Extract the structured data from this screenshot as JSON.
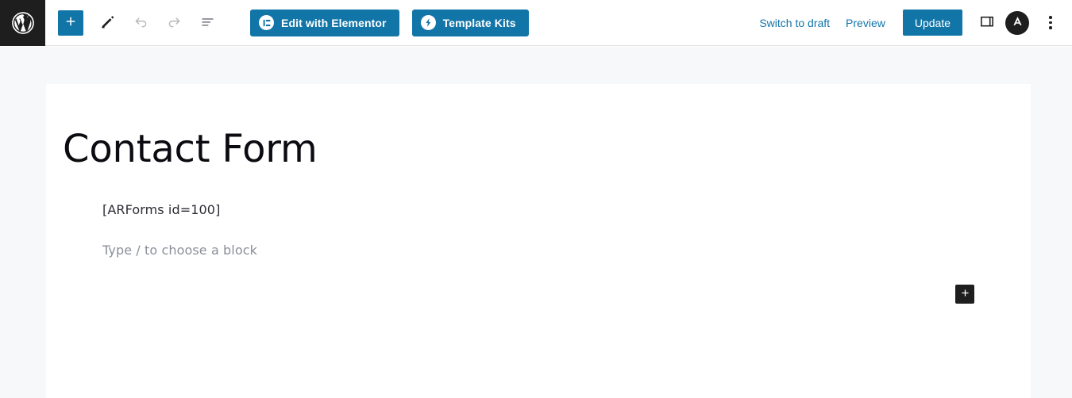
{
  "app": {
    "name": "WordPress Block Editor",
    "accent_blue": "#1275a8",
    "dark": "#1e1e1e",
    "canvas_bg": "#f7f8f9"
  },
  "header": {
    "wp_logo_label": "W",
    "tools": [
      {
        "name": "add-block-button",
        "label": "+",
        "title": "Toggle block inserter"
      },
      {
        "name": "tools-pencil-button",
        "label": "",
        "title": "Tools"
      },
      {
        "name": "undo-button",
        "label": "",
        "title": "Undo"
      },
      {
        "name": "redo-button",
        "label": "",
        "title": "Redo"
      },
      {
        "name": "list-view-button",
        "label": "",
        "title": "List view"
      }
    ],
    "plugin_buttons": [
      {
        "label": "Edit with Elementor",
        "icon": "elementor-icon"
      },
      {
        "label": "Template Kits",
        "icon": "lightning-bolt-icon"
      }
    ],
    "switch_to_draft_label": "Switch to draft",
    "preview_label": "Preview",
    "update_label": "Update",
    "sidebar_toggle_title": "Settings",
    "avatar_label": "A",
    "options_menu_title": "Options"
  },
  "content": {
    "post_title": "Contact Form",
    "shortcode_block": "[ARForms id=100]",
    "empty_block_placeholder": "Type / to choose a block",
    "appender_label": "+"
  }
}
